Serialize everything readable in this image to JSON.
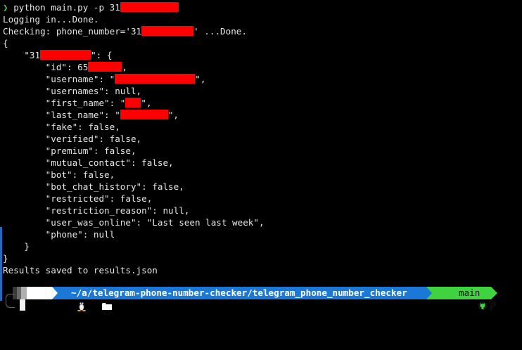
{
  "terminal": {
    "prompt_glyph": "❯",
    "command": "python main.py -p 31",
    "line_login": "Logging in...Done.",
    "check_prefix": "Checking: phone_number='31",
    "check_suffix": "' ...Done.",
    "brace_open": "{",
    "key_prefix": "    \"31",
    "key_suffix": "\": {",
    "id_prefix": "        \"id\": 65",
    "id_suffix": ",",
    "username_prefix": "        \"username\": \"",
    "username_suffix": "\",",
    "usernames": "        \"usernames\": null,",
    "first_name_prefix": "        \"first_name\": \"",
    "first_name_suffix": "\",",
    "last_name_prefix": "        \"last_name\": \"",
    "last_name_suffix": "\",",
    "fake": "        \"fake\": false,",
    "verified": "        \"verified\": false,",
    "premium": "        \"premium\": false,",
    "mutual_contact": "        \"mutual_contact\": false,",
    "bot": "        \"bot\": false,",
    "bot_chat_history": "        \"bot_chat_history\": false,",
    "restricted": "        \"restricted\": false,",
    "restriction_reason": "        \"restriction_reason\": null,",
    "user_was_online": "        \"user_was_online\": \"Last seen last week\",",
    "phone": "        \"phone\": null",
    "inner_close": "    }",
    "outer_close": "}",
    "results": "Results saved to results.json"
  },
  "powerline": {
    "os_icon": "linux-icon",
    "folder_icon": "folder-icon",
    "path": "~/a/telegram-phone-number-checker/telegram_phone_number_checker",
    "git_icon": "github-icon",
    "branch_icon": "branch-icon",
    "branch": "main"
  },
  "colors": {
    "background": "#000000",
    "text": "#e6e6e6",
    "redaction": "#ff0000",
    "path_segment": "#1b78d6",
    "git_segment": "#3fd33f",
    "gutter": "#1e6bbf",
    "prompt_chevron": "#4ac64a"
  }
}
